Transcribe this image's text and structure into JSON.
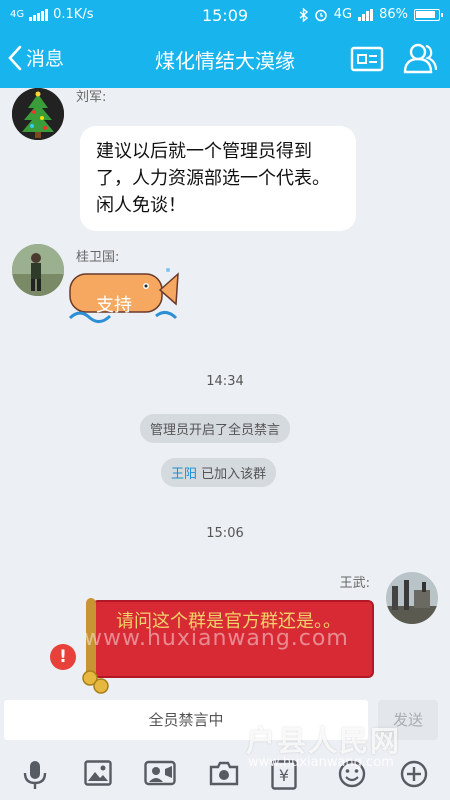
{
  "status_bar": {
    "network": "4G",
    "speed": "0.1K/s",
    "time": "15:09",
    "network_right": "4G",
    "battery": "86%"
  },
  "nav": {
    "back_label": "消息",
    "title": "煤化情结大漠缘"
  },
  "messages": [
    {
      "sender": "刘军:",
      "text": "建议以后就一个管理员得到了，人力资源部选一个代表。闲人免谈！"
    },
    {
      "sender": "桂卫国:",
      "sticker_text": "支持"
    },
    {
      "time": "14:34"
    },
    {
      "system": "管理员开启了全员禁言"
    },
    {
      "system_name": "王阳",
      "system_suffix": "已加入该群"
    },
    {
      "time": "15:06"
    },
    {
      "sender": "王武:",
      "text": "请问这个群是官方群还是。。"
    }
  ],
  "input": {
    "placeholder": "全员禁言中",
    "send_label": "发送"
  },
  "toolbar": {
    "icons": [
      "mic-icon",
      "image-icon",
      "video-icon",
      "camera-icon",
      "red-packet-icon",
      "emoji-icon",
      "plus-icon"
    ]
  },
  "watermark": {
    "center_url": "www.huxianwang.com",
    "logo": "户县人民网",
    "url": "www.huxianwang.com"
  },
  "colors": {
    "accent": "#18b4ed",
    "bubble_red": "#d82a35",
    "system_link": "#1a8fd1"
  }
}
